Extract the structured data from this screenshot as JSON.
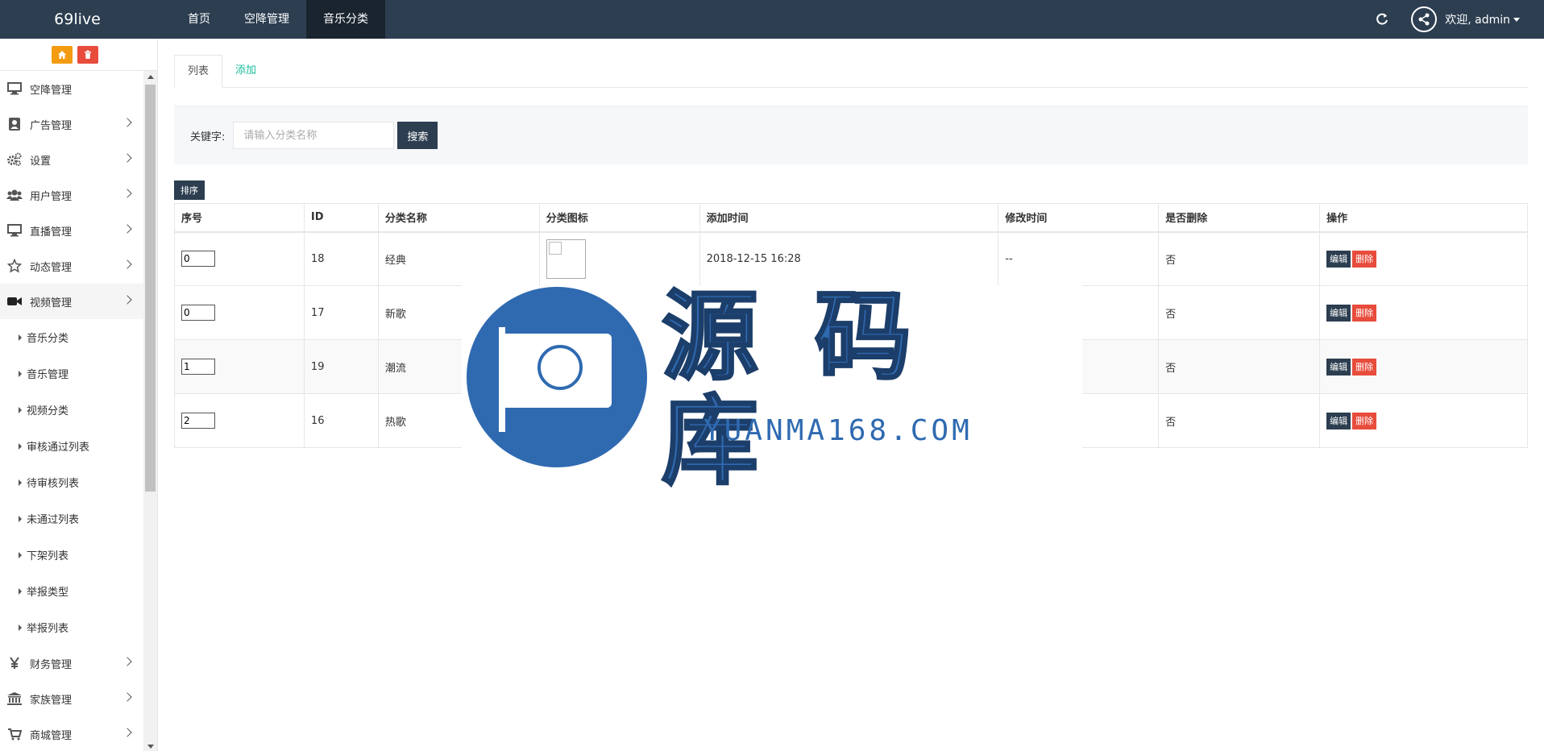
{
  "topbar": {
    "brand": "69live",
    "nav": [
      {
        "label": "首页"
      },
      {
        "label": "空降管理"
      },
      {
        "label": "音乐分类"
      }
    ],
    "user_label": "欢迎, admin"
  },
  "sidebar": {
    "menu_top": [
      {
        "label": "空降管理",
        "icon": "monitor-icon"
      },
      {
        "label": "广告管理",
        "icon": "ad-icon"
      },
      {
        "label": "设置",
        "icon": "gears-icon"
      },
      {
        "label": "用户管理",
        "icon": "users-icon"
      },
      {
        "label": "直播管理",
        "icon": "monitor-icon"
      },
      {
        "label": "动态管理",
        "icon": "star-icon"
      },
      {
        "label": "视频管理",
        "icon": "video-camera-icon"
      }
    ],
    "submenu": [
      {
        "label": "音乐分类"
      },
      {
        "label": "音乐管理"
      },
      {
        "label": "视频分类"
      },
      {
        "label": "审核通过列表"
      },
      {
        "label": "待审核列表"
      },
      {
        "label": "未通过列表"
      },
      {
        "label": "下架列表"
      },
      {
        "label": "举报类型"
      },
      {
        "label": "举报列表"
      }
    ],
    "menu_bottom": [
      {
        "label": "财务管理",
        "icon": "yen-icon"
      },
      {
        "label": "家族管理",
        "icon": "bank-icon"
      },
      {
        "label": "商城管理",
        "icon": "cart-icon"
      }
    ]
  },
  "tabs": [
    {
      "label": "列表"
    },
    {
      "label": "添加"
    }
  ],
  "search": {
    "label": "关键字:",
    "placeholder": "请输入分类名称",
    "button": "搜索"
  },
  "sort_button": "排序",
  "table": {
    "headers": [
      "序号",
      "ID",
      "分类名称",
      "分类图标",
      "添加时间",
      "修改时间",
      "是否删除",
      "操作"
    ],
    "rows": [
      {
        "order": "0",
        "id": "18",
        "name": "经典",
        "added": "2018-12-15 16:28",
        "modified": "--",
        "deleted": "否"
      },
      {
        "order": "0",
        "id": "17",
        "name": "新歌",
        "added": "",
        "modified": "",
        "deleted": "否"
      },
      {
        "order": "1",
        "id": "19",
        "name": "潮流",
        "added": "",
        "modified": "",
        "deleted": "否"
      },
      {
        "order": "2",
        "id": "16",
        "name": "热歌",
        "added": "",
        "modified": "",
        "deleted": "否"
      }
    ],
    "edit_label": "编辑",
    "delete_label": "删除"
  },
  "watermark": {
    "title": "源码库",
    "url": "YUANMA168.COM"
  },
  "colors": {
    "navbar": "#2c3e50",
    "navbar_active": "#1a242f",
    "link": "#18bc9c",
    "danger": "#e74c3c",
    "warning": "#f39c12",
    "watermark_blue": "#2f6ab1"
  }
}
